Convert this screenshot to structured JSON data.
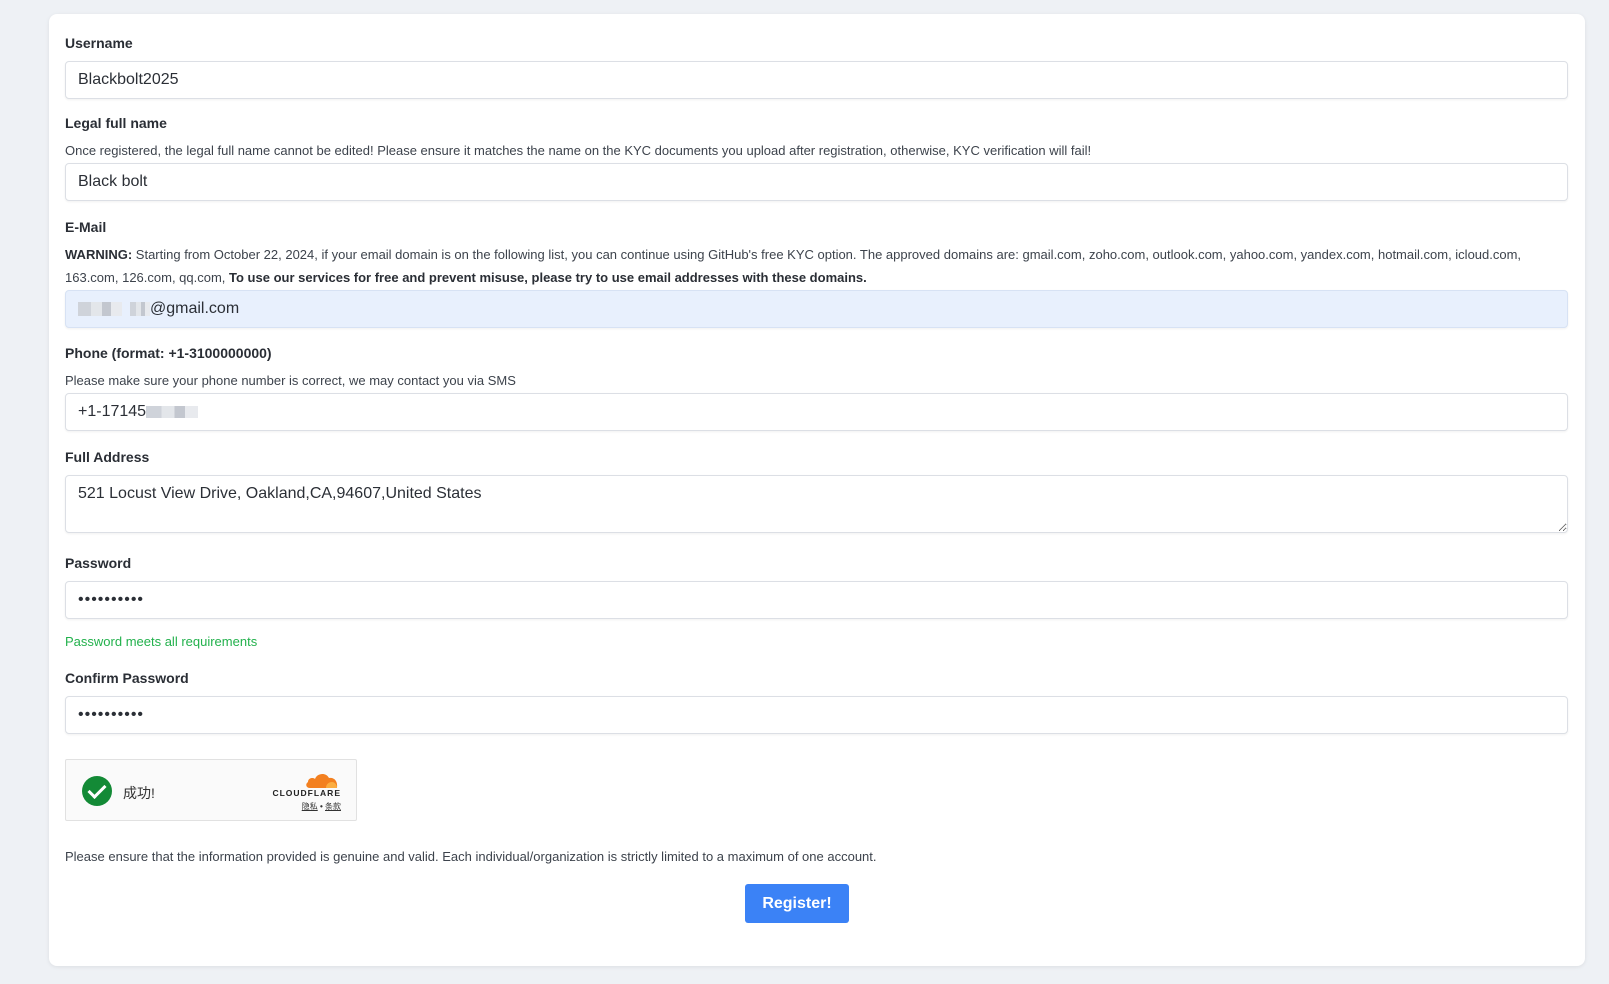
{
  "form": {
    "username": {
      "label": "Username",
      "value": "Blackbolt2025"
    },
    "legal_name": {
      "label": "Legal full name",
      "help": "Once registered, the legal full name cannot be edited! Please ensure it matches the name on the KYC documents you upload after registration, otherwise, KYC verification will fail!",
      "value": "Black bolt"
    },
    "email": {
      "label": "E-Mail",
      "warning_prefix": "WARNING:",
      "warning_text": " Starting from October 22, 2024, if your email domain is on the following list, you can continue using GitHub's free KYC option. The approved domains are: gmail.com, zoho.com, outlook.com, yahoo.com, yandex.com, hotmail.com, icloud.com, 163.com, 126.com, qq.com, ",
      "warning_bold": "To use our services for free and prevent misuse, please try to use email addresses with these domains.",
      "value_suffix": "@gmail.com"
    },
    "phone": {
      "label": "Phone (format: +1-3100000000)",
      "help": "Please make sure your phone number is correct, we may contact you via SMS",
      "value_prefix": "+1-17145"
    },
    "address": {
      "label": "Full Address",
      "value": "521 Locust View Drive, Oakland,CA,94607,United States"
    },
    "password": {
      "label": "Password",
      "value": "••••••••••",
      "status": "Password meets all requirements"
    },
    "confirm_password": {
      "label": "Confirm Password",
      "value": "••••••••••"
    },
    "captcha": {
      "status": "成功!",
      "brand": "CLOUDFLARE",
      "privacy": "隐私",
      "separator": "•",
      "terms": "条款"
    },
    "notice": "Please ensure that the information provided is genuine and valid. Each individual/organization is strictly limited to a maximum of one account.",
    "submit_label": "Register!"
  },
  "colors": {
    "accent": "#3b82f6",
    "success": "#22b14c",
    "cloudflare_orange": "#f38020"
  }
}
